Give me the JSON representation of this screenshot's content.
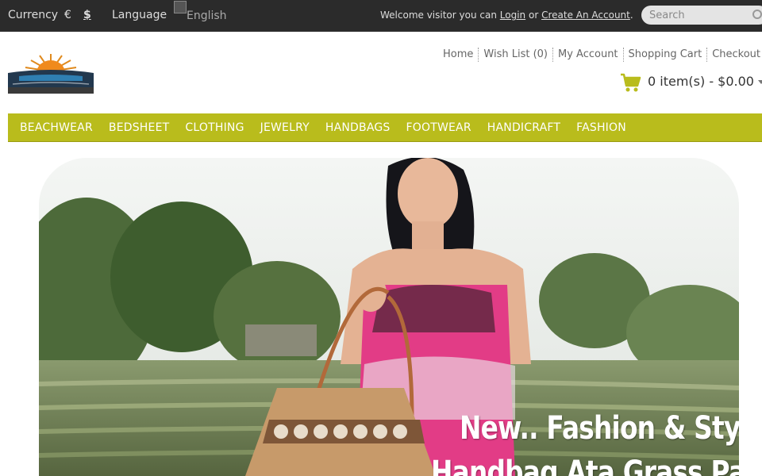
{
  "topbar": {
    "currency_label": "Currency",
    "currencies": [
      "€",
      "$"
    ],
    "selected_currency": "$",
    "language_label": "Language",
    "language_alt": "English",
    "welcome_prefix": "Welcome visitor you can",
    "login_label": "Login",
    "or_text": "or",
    "create_account_label": "Create An Account",
    "period": ".",
    "search_placeholder": "Search",
    "search_icon": "search-icon"
  },
  "header": {
    "toplinks": [
      "Home",
      "Wish List (0)",
      "My Account",
      "Shopping Cart",
      "Checkout"
    ],
    "cart_text": "0 item(s) - $0.00",
    "cart_icon": "shopping-cart-icon"
  },
  "nav": {
    "items": [
      "BEACHWEAR",
      "BEDSHEET",
      "CLOTHING",
      "JEWELRY",
      "HANDBAGS",
      "FOOTWEAR",
      "HANDICRAFT",
      "FASHION"
    ]
  },
  "banner": {
    "caption": "New.. Fashion & Style",
    "subcaption": "Handbag Ata Grass Pattern"
  },
  "colors": {
    "topbar_bg": "#2b2b2b",
    "nav_bg": "#b9bc1c",
    "cart_icon": "#b9bc1c"
  }
}
